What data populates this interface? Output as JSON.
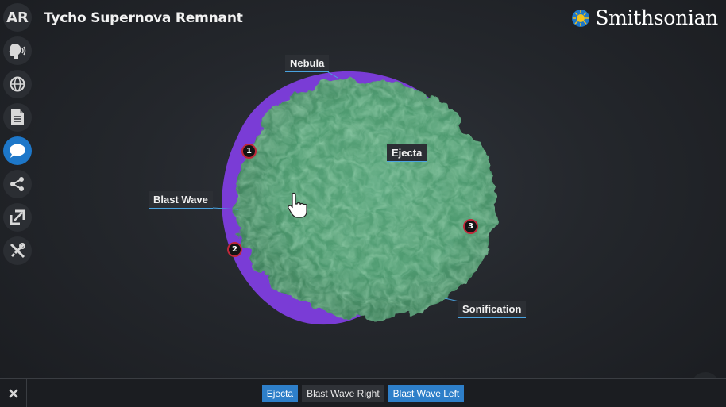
{
  "header": {
    "title": "Tycho Supernova Remnant",
    "brand": "Smithsonian"
  },
  "sidebar": {
    "items": [
      {
        "name": "ar",
        "label": "AR",
        "icon": "ar-icon"
      },
      {
        "name": "audio",
        "icon": "speaking-head-icon"
      },
      {
        "name": "language",
        "icon": "globe-icon"
      },
      {
        "name": "document",
        "icon": "document-icon"
      },
      {
        "name": "annotations",
        "icon": "speech-bubble-icon",
        "active": true
      },
      {
        "name": "share",
        "icon": "share-icon"
      },
      {
        "name": "fullscreen",
        "icon": "expand-icon"
      },
      {
        "name": "tools",
        "icon": "tools-icon"
      }
    ]
  },
  "annotations": {
    "labels": {
      "nebula": "Nebula",
      "ejecta": "Ejecta",
      "blast_wave": "Blast Wave",
      "sonification": "Sonification"
    },
    "markers": [
      "1",
      "2",
      "3"
    ]
  },
  "tour": {
    "tabs": [
      {
        "label": "Ejecta",
        "active": true
      },
      {
        "label": "Blast Wave Right",
        "active": false
      },
      {
        "label": "Blast Wave Left",
        "active": true
      }
    ]
  },
  "help": {
    "label": "?"
  },
  "colors": {
    "accent": "#1d77c9",
    "remnant_outer": "#7a3cd6",
    "remnant_ejecta": "#5fb785",
    "marker_ring": "#c0283a"
  }
}
